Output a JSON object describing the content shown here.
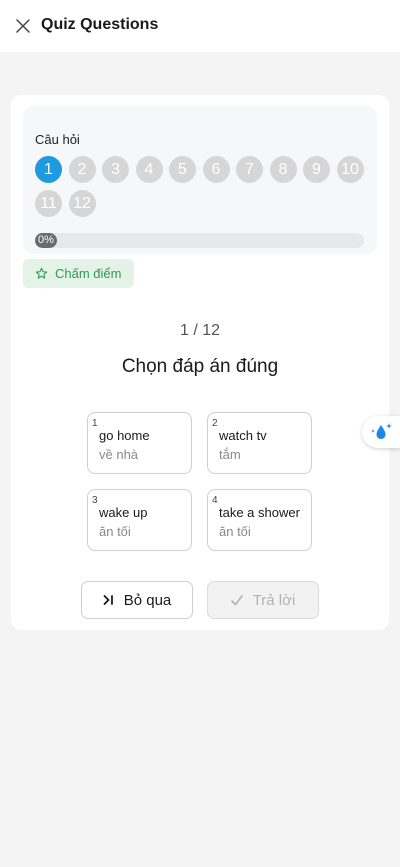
{
  "header": {
    "title": "Quiz Questions",
    "close_icon": "close-icon"
  },
  "question_panel": {
    "label": "Câu hỏi",
    "numbers": [
      "1",
      "2",
      "3",
      "4",
      "5",
      "6",
      "7",
      "8",
      "9",
      "10",
      "11",
      "12"
    ],
    "active_index": 0
  },
  "progress": {
    "percent": 0,
    "label": "0%"
  },
  "score_button": {
    "label": "Chấm điểm",
    "icon": "star-icon"
  },
  "quiz": {
    "counter": "1 / 12",
    "prompt": "Chọn đáp án đúng",
    "options": [
      {
        "num": "1",
        "en": "go home",
        "vi": "về nhà"
      },
      {
        "num": "2",
        "en": "watch tv",
        "vi": "tắm"
      },
      {
        "num": "3",
        "en": "wake up",
        "vi": "ăn tối"
      },
      {
        "num": "4",
        "en": "take a shower",
        "vi": "ăn tối"
      }
    ]
  },
  "actions": {
    "skip_label": "Bỏ qua",
    "skip_icon": "skip-icon",
    "answer_label": "Trả lời",
    "answer_icon": "check-icon"
  },
  "floating": {
    "icon": "water-drop-sparkle-icon"
  },
  "colors": {
    "accent_blue": "#1e9be0",
    "score_green": "#2f9a53",
    "score_bg": "#e3f3e8",
    "inactive_number": "#d6d6d6"
  }
}
